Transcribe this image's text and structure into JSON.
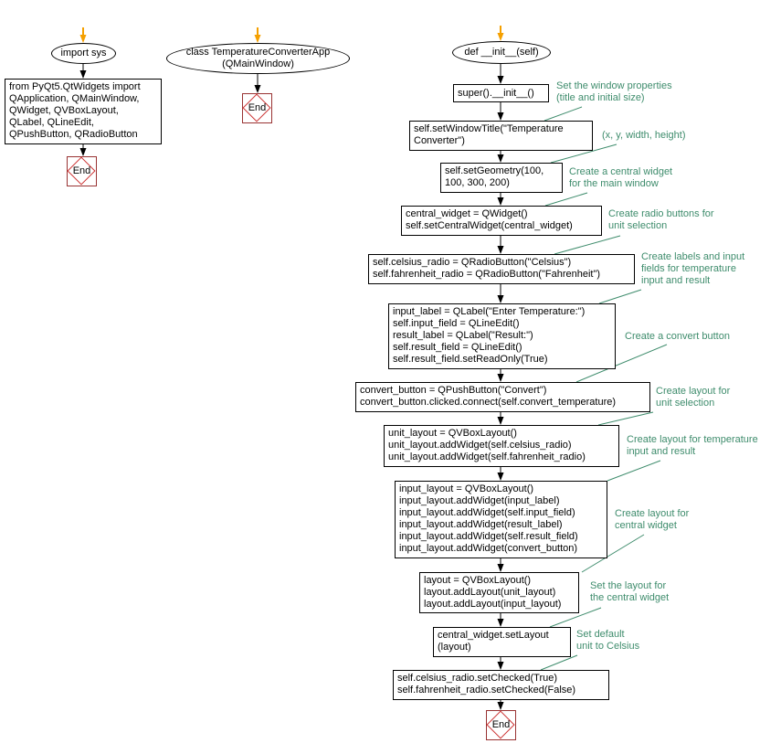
{
  "colors": {
    "comment": "#3e8c6c",
    "end_border": "#993333",
    "start_arrow": "#f5a000",
    "line": "#000000"
  },
  "flow1": {
    "start": "import sys",
    "import_box": "from PyQt5.QtWidgets import\nQApplication, QMainWindow,\nQWidget, QVBoxLayout,\nQLabel, QLineEdit,\nQPushButton, QRadioButton",
    "end": "End"
  },
  "flow2": {
    "start": "class TemperatureConverterApp\n(QMainWindow)",
    "end": "End"
  },
  "flow3": {
    "start": "def __init__(self)",
    "nodes": [
      "super().__init__()",
      "self.setWindowTitle(\"Temperature\nConverter\")",
      "self.setGeometry(100,\n100, 300, 200)",
      "central_widget = QWidget()\nself.setCentralWidget(central_widget)",
      "self.celsius_radio = QRadioButton(\"Celsius\")\nself.fahrenheit_radio = QRadioButton(\"Fahrenheit\")",
      "input_label = QLabel(\"Enter Temperature:\")\nself.input_field = QLineEdit()\nresult_label = QLabel(\"Result:\")\nself.result_field = QLineEdit()\nself.result_field.setReadOnly(True)",
      "convert_button = QPushButton(\"Convert\")\nconvert_button.clicked.connect(self.convert_temperature)",
      "unit_layout = QVBoxLayout()\nunit_layout.addWidget(self.celsius_radio)\nunit_layout.addWidget(self.fahrenheit_radio)",
      "input_layout = QVBoxLayout()\ninput_layout.addWidget(input_label)\ninput_layout.addWidget(self.input_field)\ninput_layout.addWidget(result_label)\ninput_layout.addWidget(self.result_field)\ninput_layout.addWidget(convert_button)",
      "layout = QVBoxLayout()\nlayout.addLayout(unit_layout)\nlayout.addLayout(input_layout)",
      "central_widget.setLayout\n(layout)",
      "self.celsius_radio.setChecked(True)\nself.fahrenheit_radio.setChecked(False)"
    ],
    "comments": [
      "Set the window properties\n(title and initial size)",
      "(x, y, width, height)",
      "Create a central widget\nfor the main window",
      "Create radio buttons for\nunit selection",
      "Create labels and input\nfields for temperature\ninput and result",
      "Create a convert button",
      "Create layout for\nunit selection",
      "Create layout for temperature\ninput and result",
      "Create layout for\ncentral widget",
      "Set the layout for\nthe central widget",
      "Set default\nunit to Celsius"
    ],
    "end": "End"
  }
}
